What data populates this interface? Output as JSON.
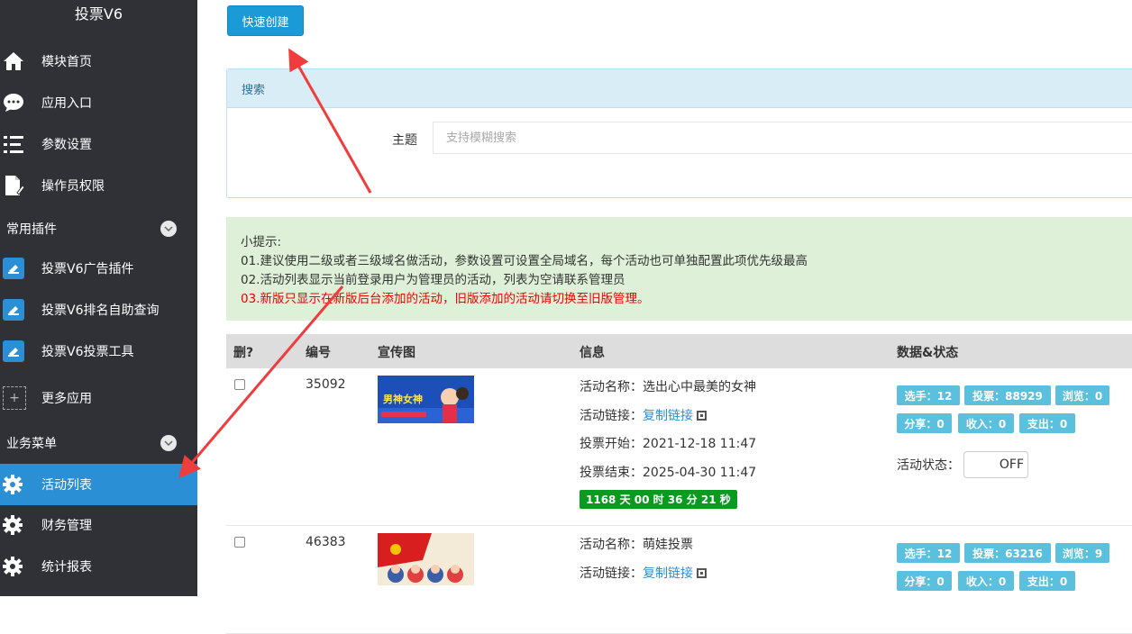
{
  "sidebar": {
    "title": "投票V6",
    "items": [
      {
        "label": "模块首页",
        "icon": "home-icon"
      },
      {
        "label": "应用入口",
        "icon": "chat-icon"
      },
      {
        "label": "参数设置",
        "icon": "list-settings-icon"
      },
      {
        "label": "操作员权限",
        "icon": "document-edit-icon"
      }
    ],
    "section_plugins": "常用插件",
    "plugins": [
      {
        "label": "投票V6广告插件",
        "icon": "plugin-icon"
      },
      {
        "label": "投票V6排名自助查询",
        "icon": "plugin-icon"
      },
      {
        "label": "投票V6投票工具",
        "icon": "plugin-icon"
      }
    ],
    "more_apps": "更多应用",
    "section_business": "业务菜单",
    "business": [
      {
        "label": "活动列表",
        "icon": "gear-icon",
        "active": true
      },
      {
        "label": "财务管理",
        "icon": "gear-icon"
      },
      {
        "label": "统计报表",
        "icon": "gear-icon"
      }
    ]
  },
  "toolbar": {
    "create_label": "快速创建"
  },
  "search": {
    "header": "搜索",
    "subject_label": "主题",
    "subject_placeholder": "支持模糊搜索"
  },
  "tips": {
    "title": "小提示:",
    "line1": "01.建议使用二级或者三级域名做活动，参数设置可设置全局域名，每个活动也可单独配置此项优先级最高",
    "line2": "02.活动列表显示当前登录用户为管理员的活动，列表为空请联系管理员",
    "line3": "03.新版只显示在新版后台添加的活动，旧版添加的活动请切换至旧版管理。"
  },
  "table": {
    "headers": {
      "del": "删?",
      "id": "编号",
      "image": "宣传图",
      "info": "信息",
      "stats": "数据&状态"
    },
    "rows": [
      {
        "id": "35092",
        "name": "活动名称：选出心中最美的女神",
        "link_label": "活动链接：",
        "link_text": "复制链接",
        "start": "投票开始：2021-12-18 11:47",
        "end": "投票结束：2025-04-30 11:47",
        "countdown": "1168 天 00 时 36 分 21 秒",
        "image_caption": "男神女神",
        "players": "选手：12",
        "votes": "投票：88929",
        "views": "浏览：0",
        "shares": "分享：0",
        "income": "收入：0",
        "expense": "支出：0",
        "status_label": "活动状态：",
        "status_value": "OFF"
      },
      {
        "id": "46383",
        "name": "活动名称：萌娃投票",
        "link_label": "活动链接：",
        "link_text": "复制链接",
        "players": "选手：12",
        "votes": "投票：63216",
        "views": "浏览：9",
        "shares": "分享：0",
        "income": "收入：0",
        "expense": "支出：0"
      }
    ]
  },
  "colors": {
    "sidebar_bg": "#2f3137",
    "accent": "#2b8fd6",
    "badge": "#5bc0de",
    "annotation_arrow": "#f03c3c"
  }
}
